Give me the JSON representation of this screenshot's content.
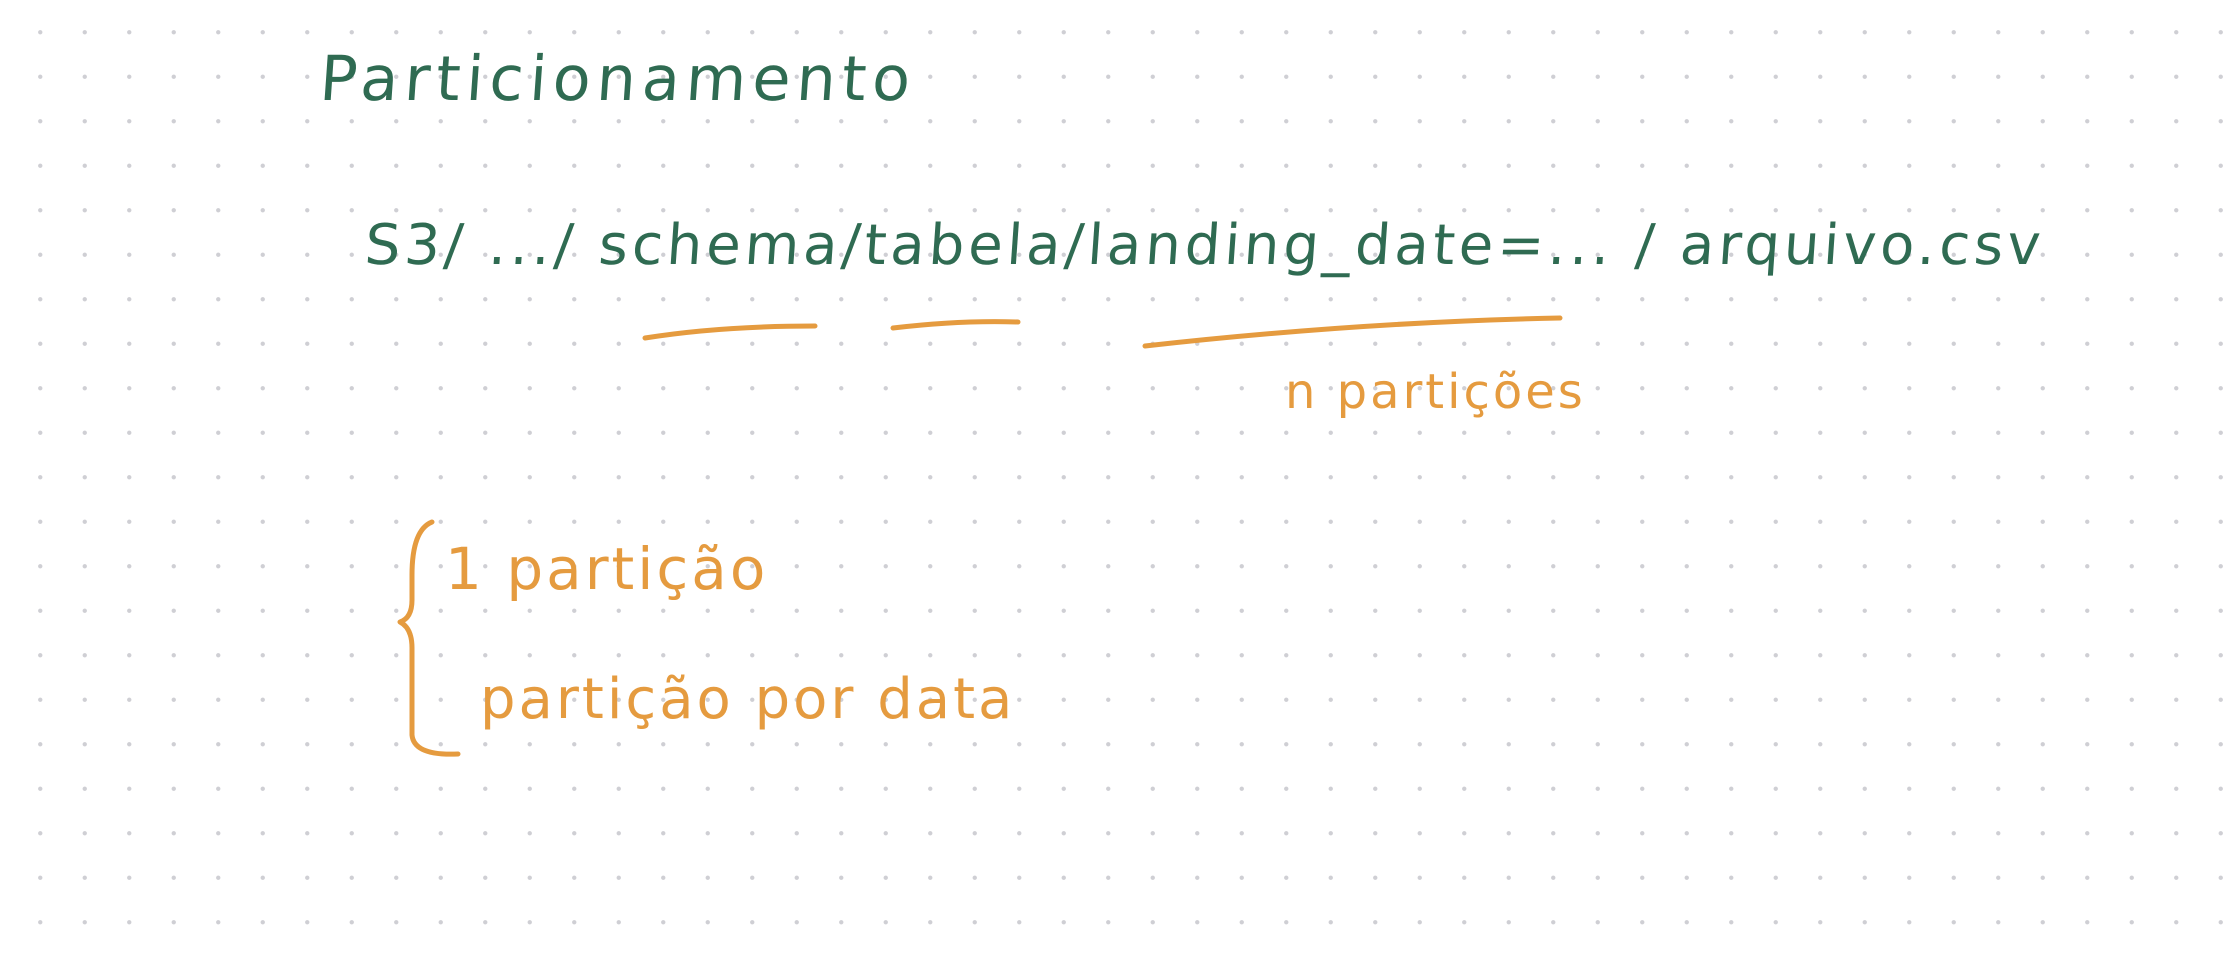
{
  "colors": {
    "ink_green": "#2f6b52",
    "ink_orange": "#e59b3f",
    "dot_grid": "#cfcfd4",
    "background": "#ffffff"
  },
  "note": {
    "title": "Particionamento",
    "path": "S3/ .../ schema/tabela/landing_date=... / arquivo.csv",
    "partitions_label": "n partições",
    "options": [
      "1 partição",
      "partição por data"
    ]
  }
}
